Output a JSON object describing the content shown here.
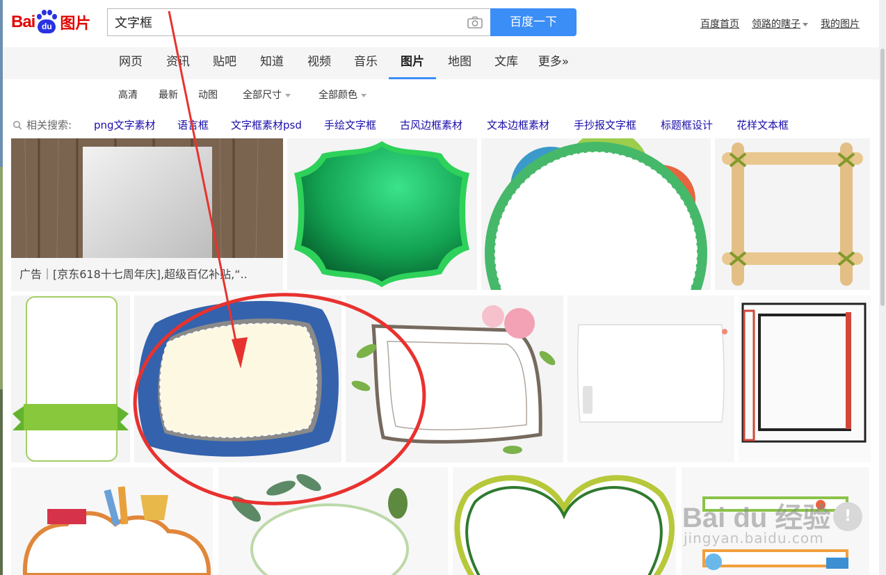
{
  "logo": {
    "bai": "Bai",
    "du": "du",
    "tupian": "图片"
  },
  "search": {
    "value": "文字框",
    "button": "百度一下"
  },
  "toplinks": {
    "home": "百度首页",
    "user": "领路的瞎子",
    "mine": "我的图片"
  },
  "nav": {
    "tabs": [
      "网页",
      "资讯",
      "贴吧",
      "知道",
      "视频",
      "音乐",
      "图片",
      "地图",
      "文库",
      "更多»"
    ],
    "active": "图片"
  },
  "filters": {
    "hd": "高清",
    "latest": "最新",
    "animated": "动图",
    "size": "全部尺寸",
    "color": "全部颜色"
  },
  "related": {
    "label": "相关搜索:",
    "items": [
      "png文字素材",
      "语言框",
      "文字框素材psd",
      "手绘文字框",
      "古风边框素材",
      "文本边框素材",
      "手抄报文字框",
      "标题框设计",
      "花样文本框"
    ]
  },
  "ad": {
    "caption": "广告｜[京东618十七周年庆],超级百亿补贴,“.."
  },
  "watermark": {
    "main": "Bai du 经验",
    "sub": "jingyan.baidu.com",
    "bang": "!"
  },
  "colors": {
    "accent": "#3a8ef6",
    "link": "#1a0dab",
    "brand_red": "#e10602",
    "brand_blue": "#2932e1",
    "annotation": "#e8322f"
  }
}
